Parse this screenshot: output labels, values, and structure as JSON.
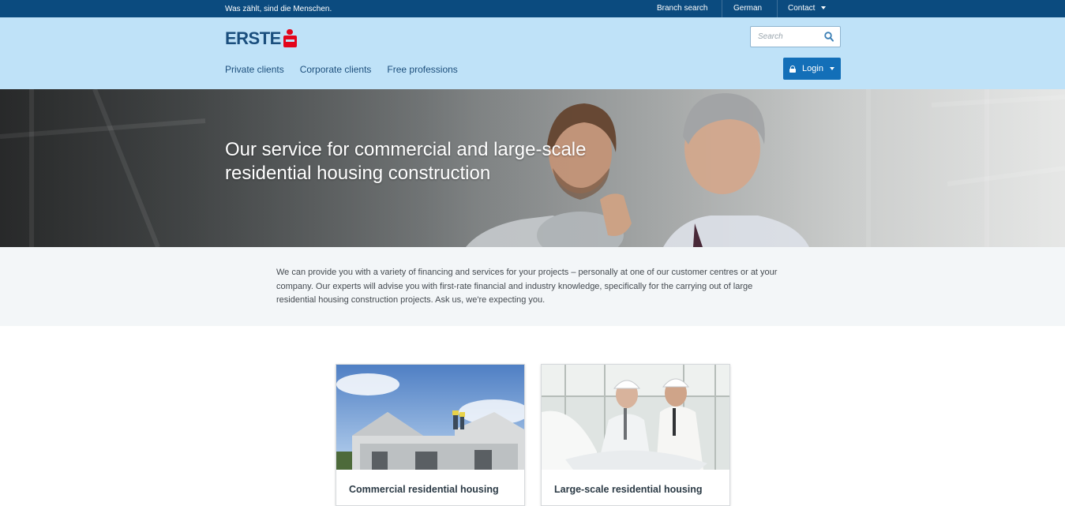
{
  "topbar": {
    "tagline": "Was zählt, sind die Menschen.",
    "branch_search": "Branch search",
    "language": "German",
    "contact": "Contact"
  },
  "header": {
    "logo_text": "ERSTE",
    "search_placeholder": "Search",
    "nav": [
      "Private clients",
      "Corporate clients",
      "Free professions"
    ],
    "login_label": "Login"
  },
  "hero": {
    "title": "Our service for commercial and large-scale residential housing construction"
  },
  "intro": {
    "text": "We can provide you with a variety of financing and services for your projects – personally at one of our customer centres or at your company. Our experts will advise you with first-rate financial and industry knowledge, specifically for the carrying out of large residential housing construction projects. Ask us, we're expecting you."
  },
  "cards": [
    {
      "title": "Commercial residential housing"
    },
    {
      "title": "Large-scale residential housing"
    }
  ],
  "colors": {
    "topbar": "#0b4b7f",
    "header": "#bfe2f8",
    "accent": "#136fb8",
    "logo_red": "#e3051b",
    "logo_blue": "#1a4e7d"
  }
}
